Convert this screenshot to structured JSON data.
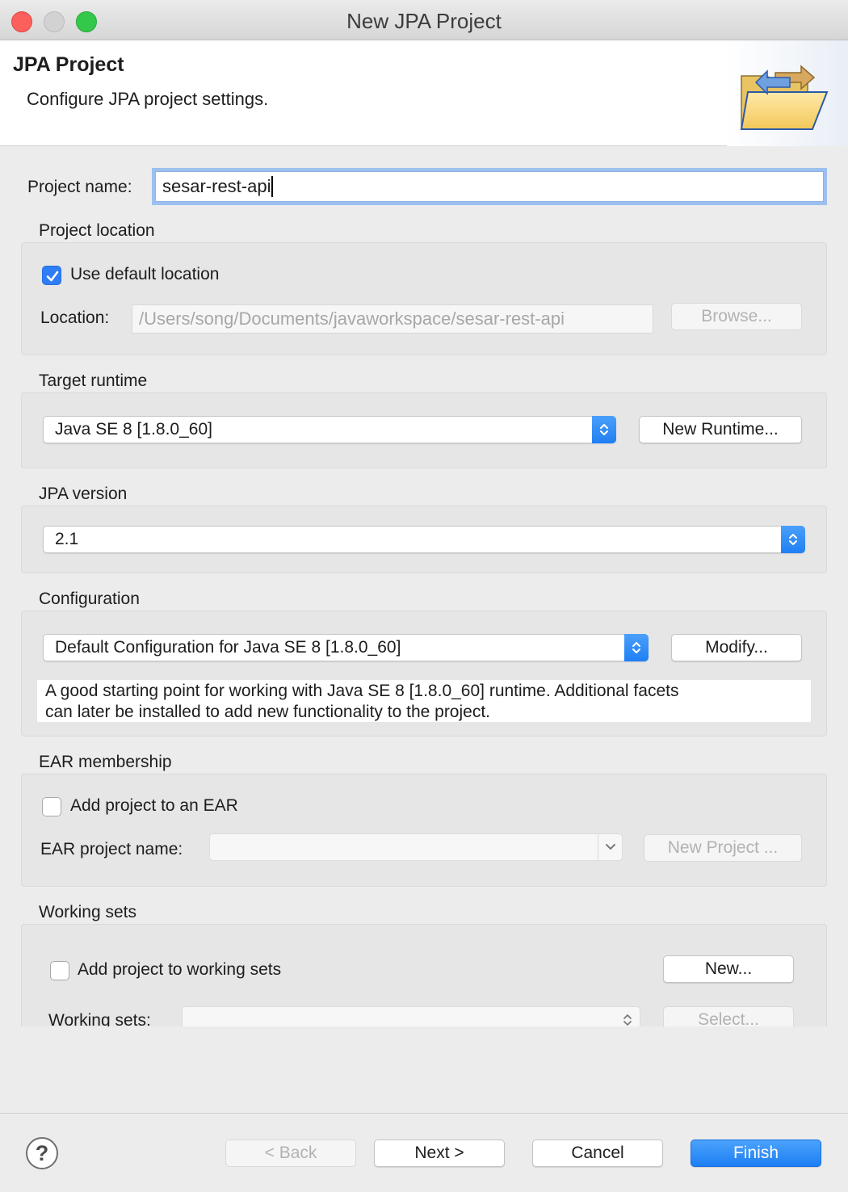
{
  "window": {
    "title": "New JPA Project"
  },
  "header": {
    "title": "JPA Project",
    "description": "Configure JPA project settings."
  },
  "project_name": {
    "label": "Project name:",
    "value": "sesar-rest-api"
  },
  "project_location": {
    "section_label": "Project location",
    "use_default_label": "Use default location",
    "use_default_checked": true,
    "location_label": "Location:",
    "location_value": "/Users/song/Documents/javaworkspace/sesar-rest-api",
    "browse_label": "Browse..."
  },
  "target_runtime": {
    "section_label": "Target runtime",
    "selected": "Java SE 8 [1.8.0_60]",
    "new_runtime_label": "New Runtime..."
  },
  "jpa_version": {
    "section_label": "JPA version",
    "selected": "2.1"
  },
  "configuration": {
    "section_label": "Configuration",
    "selected": "Default Configuration for Java SE 8 [1.8.0_60]",
    "modify_label": "Modify...",
    "description_line1": "A good starting point for working with Java SE 8 [1.8.0_60] runtime. Additional facets",
    "description_line2": "can later be installed to add new functionality to the project."
  },
  "ear_membership": {
    "section_label": "EAR membership",
    "add_label": "Add project to an EAR",
    "add_checked": false,
    "ear_name_label": "EAR project name:",
    "ear_name_value": "",
    "new_project_label": "New Project ..."
  },
  "working_sets": {
    "section_label": "Working sets",
    "add_label": "Add project to working sets",
    "add_checked": false,
    "new_label": "New...",
    "working_sets_label": "Working sets:",
    "working_sets_value": "",
    "select_label": "Select..."
  },
  "footer": {
    "help_label": "?",
    "back_label": "< Back",
    "next_label": "Next >",
    "cancel_label": "Cancel",
    "finish_label": "Finish"
  },
  "colors": {
    "accent": "#1d7ff5",
    "focus_ring": "#9cc0ef",
    "close": "#fc605c",
    "maximize": "#34c84a"
  },
  "icons": [
    "folder-arrows-icon",
    "checkmark-icon",
    "up-down-chevron-icon",
    "chevron-down-icon",
    "help-icon"
  ]
}
